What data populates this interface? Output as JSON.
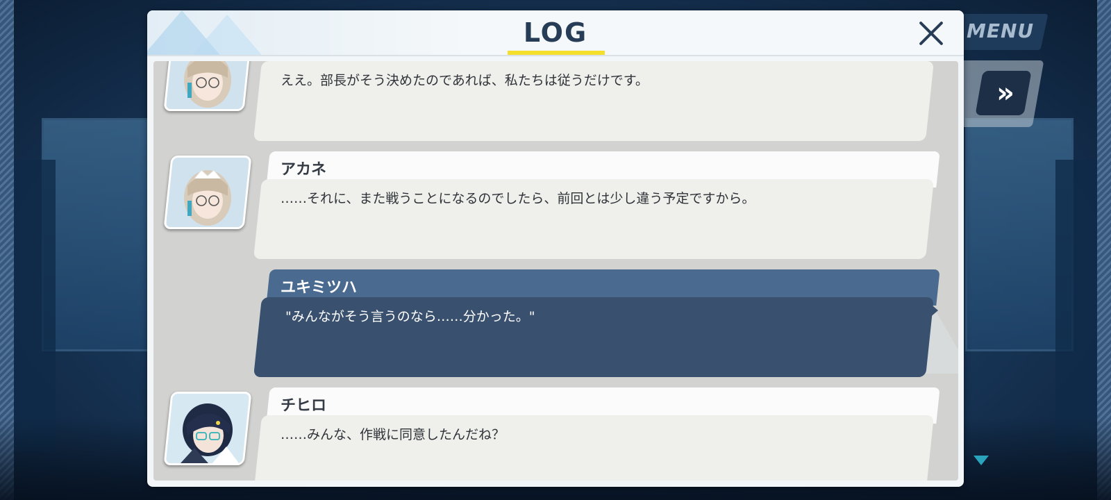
{
  "background": {
    "menu_label": "MENU",
    "skip_icon": "»"
  },
  "panel": {
    "title": "LOG",
    "close_icon": "close-icon"
  },
  "log": [
    {
      "speaker": "",
      "text": "ええ。部長がそう決めたのであれば、私たちは従うだけです。",
      "avatar": "maid-glasses-portrait"
    },
    {
      "speaker": "アカネ",
      "text": "……それに、また戦うことになるのでしたら、前回とは少し違う予定ですから。",
      "avatar": "maid-glasses-portrait"
    },
    {
      "speaker": "ユキミツハ",
      "text": "\"みんながそう言うのなら……分かった。\""
    },
    {
      "speaker": "チヒロ",
      "text": "……みんな、作戦に同意したんだね？",
      "avatar": "dark-hair-glasses-portrait"
    }
  ],
  "colors": {
    "accent": "#f5df2d",
    "title": "#273c56",
    "player_bubble": "#39506f",
    "player_name": "#4a6a8f"
  }
}
